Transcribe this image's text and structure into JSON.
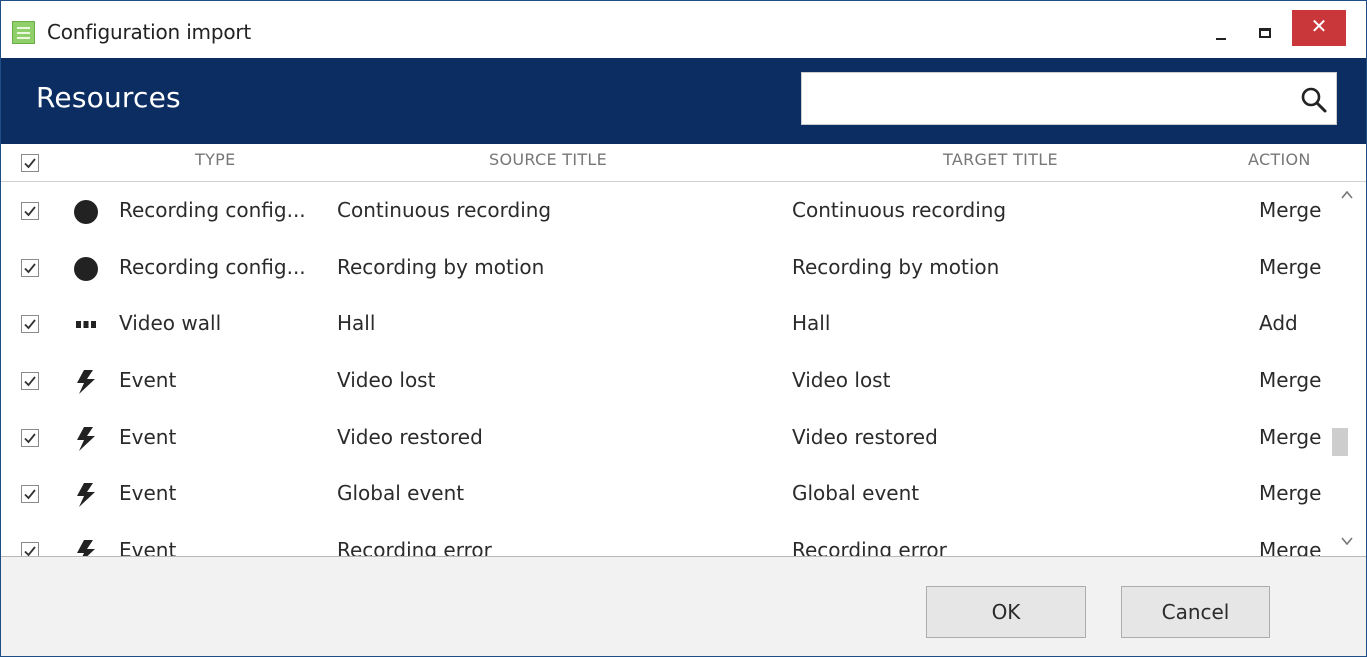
{
  "window": {
    "title": "Configuration import",
    "minimize_icon": "minimize-icon",
    "maximize_icon": "maximize-icon",
    "close_label": "✕"
  },
  "header": {
    "title": "Resources",
    "search_placeholder": "",
    "search_value": "",
    "search_icon": "search-icon",
    "background_color": "#0b2d61"
  },
  "columns": {
    "type": "TYPE",
    "source": "SOURCE TITLE",
    "target": "TARGET TITLE",
    "action": "ACTION"
  },
  "rows": [
    {
      "checked": true,
      "icon": "circle-icon",
      "type": "Recording config...",
      "source": "Continuous recording",
      "target": "Continuous recording",
      "action": "Merge"
    },
    {
      "checked": true,
      "icon": "circle-icon",
      "type": "Recording config...",
      "source": "Recording by motion",
      "target": "Recording by motion",
      "action": "Merge"
    },
    {
      "checked": true,
      "icon": "video-wall-icon",
      "type": "Video wall",
      "source": "Hall",
      "target": "Hall",
      "action": "Add"
    },
    {
      "checked": true,
      "icon": "lightning-icon",
      "type": "Event",
      "source": "Video lost",
      "target": "Video lost",
      "action": "Merge"
    },
    {
      "checked": true,
      "icon": "lightning-icon",
      "type": "Event",
      "source": "Video restored",
      "target": "Video restored",
      "action": "Merge"
    },
    {
      "checked": true,
      "icon": "lightning-icon",
      "type": "Event",
      "source": "Global event",
      "target": "Global event",
      "action": "Merge"
    },
    {
      "checked": true,
      "icon": "lightning-icon",
      "type": "Event",
      "source": "Recording error",
      "target": "Recording error",
      "action": "Merge"
    }
  ],
  "footer": {
    "ok_label": "OK",
    "cancel_label": "Cancel"
  },
  "colors": {
    "close_button": "#c9373a",
    "app_icon": "#8fd06a"
  }
}
